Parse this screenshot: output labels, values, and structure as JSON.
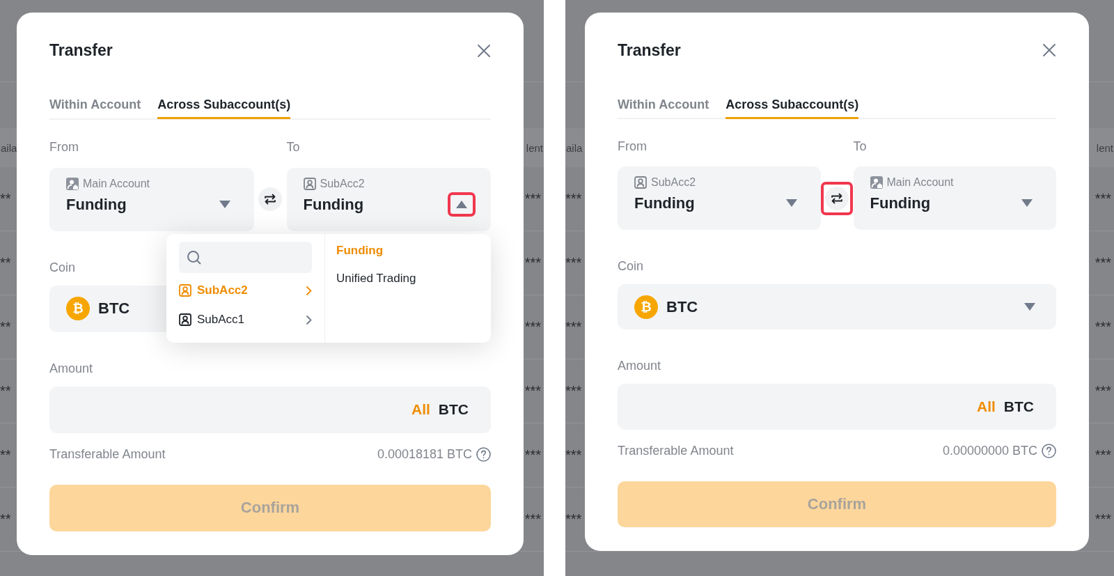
{
  "panels": [
    {
      "backdrop": {
        "header": {
          "left": "aila",
          "right": "lent"
        },
        "rows": [
          {
            "left": "**",
            "right": "***"
          },
          {
            "left": "**",
            "right": "***"
          },
          {
            "left": "**",
            "right": "***"
          },
          {
            "left": "**",
            "right": "***"
          },
          {
            "left": "**",
            "right": "***"
          },
          {
            "left": "**",
            "right": "***"
          }
        ]
      },
      "modal": {
        "title": "Transfer",
        "tabs": [
          {
            "label": "Within Account",
            "selected": false
          },
          {
            "label": "Across Subaccount(s)",
            "selected": true
          }
        ],
        "from": {
          "label": "From",
          "account": "Main Account",
          "kind": "main",
          "wallet": "Funding",
          "expanded": false,
          "highlighted": false
        },
        "swap": {
          "highlighted": false
        },
        "to": {
          "label": "To",
          "account": "SubAcc2",
          "kind": "sub",
          "wallet": "Funding",
          "expanded": true,
          "highlighted": true
        },
        "dropdown": {
          "accounts": [
            {
              "name": "SubAcc2",
              "selected": true
            },
            {
              "name": "SubAcc1",
              "selected": false
            }
          ],
          "wallets": [
            {
              "name": "Funding",
              "selected": true
            },
            {
              "name": "Unified Trading",
              "selected": false
            }
          ]
        },
        "coin": {
          "label": "Coin",
          "glyph": "₿",
          "symbol": "BTC"
        },
        "amount": {
          "label": "Amount",
          "all": "All",
          "unit": "BTC"
        },
        "transferable": {
          "label": "Transferable Amount",
          "value": "0.00018181 BTC"
        },
        "confirm": {
          "label": "Confirm",
          "disabled": true
        }
      }
    },
    {
      "backdrop": {
        "header": {
          "left": "aila",
          "right": "lent"
        },
        "rows": [
          {
            "left": "***",
            "right": "***"
          },
          {
            "left": "***",
            "right": "***"
          },
          {
            "left": "***",
            "right": "***"
          },
          {
            "left": "***",
            "right": "***"
          },
          {
            "left": "***",
            "right": "***"
          },
          {
            "left": "***",
            "right": "***"
          }
        ]
      },
      "modal": {
        "title": "Transfer",
        "tabs": [
          {
            "label": "Within Account",
            "selected": false
          },
          {
            "label": "Across Subaccount(s)",
            "selected": true
          }
        ],
        "from": {
          "label": "From",
          "account": "SubAcc2",
          "kind": "sub",
          "wallet": "Funding",
          "expanded": false,
          "highlighted": false
        },
        "swap": {
          "highlighted": true
        },
        "to": {
          "label": "To",
          "account": "Main Account",
          "kind": "main",
          "wallet": "Funding",
          "expanded": false,
          "highlighted": false
        },
        "coin": {
          "label": "Coin",
          "glyph": "₿",
          "symbol": "BTC"
        },
        "amount": {
          "label": "Amount",
          "all": "All",
          "unit": "BTC"
        },
        "transferable": {
          "label": "Transferable Amount",
          "value": "0.00000000 BTC"
        },
        "confirm": {
          "label": "Confirm",
          "disabled": true
        }
      }
    }
  ]
}
